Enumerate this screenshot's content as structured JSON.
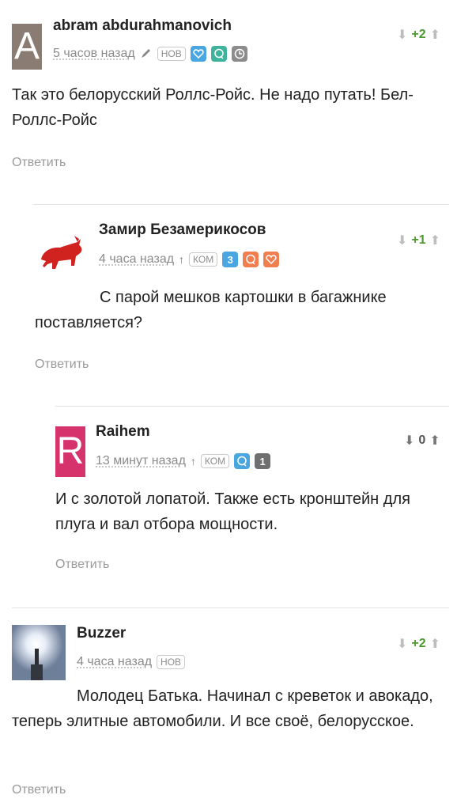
{
  "comments": [
    {
      "avatar_letter": "A",
      "avatar_color": "#8a7c72",
      "author": "abram abdurahmanovich",
      "time": "5 часов назад",
      "tag": "НОВ",
      "icons": [
        "edit-icon",
        "heart-icon",
        "comment-icon",
        "clock-icon"
      ],
      "rating": "+2",
      "text": "Так это белорусский Роллс-Ройс. Не надо путать! Бел-Роллс-Ройс",
      "reply": "Ответить"
    },
    {
      "avatar_image": "red-bull-logo",
      "author": "Замир Безамерикосов",
      "time": "4 часа назад",
      "tag": "КОМ",
      "badge_count": "3",
      "icons": [
        "up-arrow-icon",
        "comment-icon",
        "heart-icon"
      ],
      "rating": "+1",
      "text": "С парой мешков картошки в багажнике поставляется?",
      "reply": "Ответить"
    },
    {
      "avatar_letter": "R",
      "avatar_color": "#d6336c",
      "author": "Raihem",
      "time": "13 минут назад",
      "tag": "КОМ",
      "badge_count": "1",
      "icons": [
        "up-arrow-icon",
        "comment-icon"
      ],
      "rating": "0",
      "text": "И с золотой лопатой. Также есть кронштейн для плуга и вал отбора мощности.",
      "reply": "Ответить"
    },
    {
      "avatar_image": "street-lamp-photo",
      "author": "Buzzer",
      "time": "4 часа назад",
      "tag": "НОВ",
      "rating": "+2",
      "text": "Молодец Батька. Начинал с креветок и авокадо, теперь элитные автомобили. И все своё, белорусское.",
      "reply": "Ответить"
    }
  ],
  "glyphs": {
    "down": "⬇",
    "up": "⬆",
    "small_up": "↑"
  }
}
